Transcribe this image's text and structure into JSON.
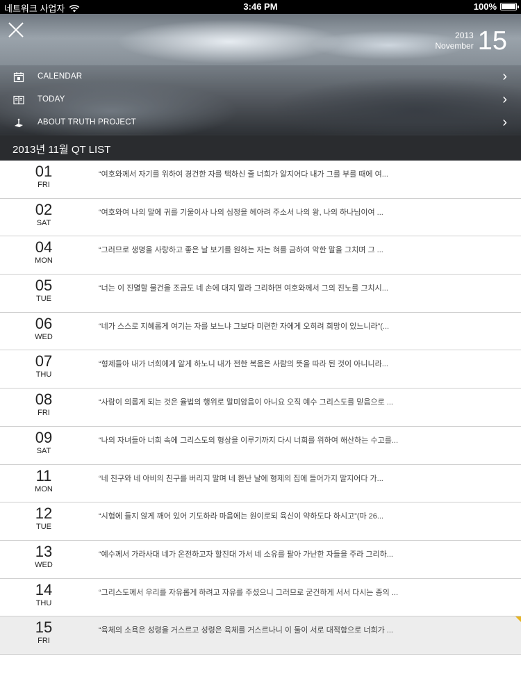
{
  "status": {
    "carrier": "네트워크 사업자",
    "time": "3:46 PM",
    "battery": "100%",
    "battery_level": 1.0
  },
  "header": {
    "year": "2013",
    "month": "November",
    "day": "15",
    "close_icon": "close-icon"
  },
  "menu": [
    {
      "label": "CALENDAR",
      "icon": "calendar-icon"
    },
    {
      "label": "TODAY",
      "icon": "book-icon"
    },
    {
      "label": "ABOUT TRUTH PROJECT",
      "icon": "info-icon"
    }
  ],
  "list_title": "2013년 11월 QT LIST",
  "items": [
    {
      "day": "01",
      "dow": "FRI",
      "text": "“여호와께서 자기를 위하여 경건한 자를 택하신 줄 너희가 알지어다 내가 그를 부를 때에 여..."
    },
    {
      "day": "02",
      "dow": "SAT",
      "text": "“여호와여 나의 말에 귀를 기울이사 나의 심정을 헤아려 주소서 나의 왕, 나의 하나님이여 ..."
    },
    {
      "day": "04",
      "dow": "MON",
      "text": "“그러므로 생명을 사랑하고 좋은 날 보기를 원하는 자는 혀를 금하여 악한 말을 그치며 그 ..."
    },
    {
      "day": "05",
      "dow": "TUE",
      "text": "“너는 이 진멸할 물건을 조금도 네 손에 대지 말라 그리하면 여호와께서 그의 진노를 그치시..."
    },
    {
      "day": "06",
      "dow": "WED",
      "text": "“네가 스스로 지혜롭게 여기는 자를 보느냐 그보다 미련한 자에게 오히려 희망이 있느니라”(..."
    },
    {
      "day": "07",
      "dow": "THU",
      "text": "“형제들아 내가 너희에게 알게 하노니 내가 전한 복음은 사람의 뜻을 따라 된 것이 아니니라..."
    },
    {
      "day": "08",
      "dow": "FRI",
      "text": "“사람이 의롭게 되는 것은 율법의 행위로 말미암음이 아니요 오직 예수 그리스도를 믿음으로 ..."
    },
    {
      "day": "09",
      "dow": "SAT",
      "text": "“나의 자녀들아 너희 속에 그리스도의 형상을 이루기까지 다시 너희를 위하여 해산하는 수고를..."
    },
    {
      "day": "11",
      "dow": "MON",
      "text": "“네 친구와 네 아비의 친구를 버리지 말며 네 환난 날에 형제의 집에 들어가지 말지어다 가..."
    },
    {
      "day": "12",
      "dow": "TUE",
      "text": "“시험에 들지 않게 깨어 있어 기도하라 마음에는 원이로되 육신이 약하도다 하시고”(마 26..."
    },
    {
      "day": "13",
      "dow": "WED",
      "text": "“예수께서 가라사대 네가 온전하고자 할진대 가서 네 소유를 팔아 가난한 자들을 주라 그리하..."
    },
    {
      "day": "14",
      "dow": "THU",
      "text": "“그리스도께서 우리를 자유롭게 하려고 자유를 주셨으니 그러므로 굳건하게 서서 다시는 종의 ..."
    },
    {
      "day": "15",
      "dow": "FRI",
      "text": "“육체의 소욕은 성령을 거스르고 성령은 육체를 거스르나니 이 둘이 서로 대적함으로 너희가 ...",
      "selected": true
    }
  ]
}
